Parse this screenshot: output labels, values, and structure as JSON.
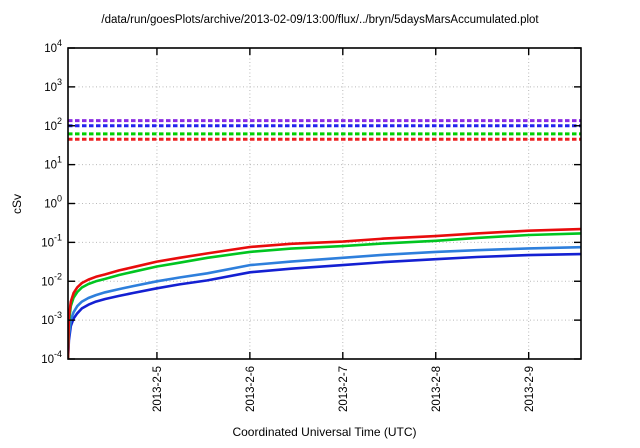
{
  "chart_data": {
    "type": "line",
    "title": "/data/run/goesPlots/archive/2013-02-09/13:00/flux/../bryn/5daysMarsAccumulated.plot",
    "xlabel": "Coordinated Universal Time (UTC)",
    "ylabel": "cSv",
    "y_scale": "log",
    "grid": true,
    "grid_color": "#b9b9b9",
    "frame_color": "#000000",
    "ylim_exponents": [
      -4,
      4
    ],
    "y_ticks_exponents": [
      4,
      3,
      2,
      1,
      0,
      -1,
      -2,
      -3,
      -4
    ],
    "y_tick_base": "10",
    "x_range_days": [
      0,
      5.52
    ],
    "x_ticks": [
      {
        "label": "2013-2-5",
        "t": 0.957
      },
      {
        "label": "2013-2-6",
        "t": 1.957
      },
      {
        "label": "2013-2-7",
        "t": 2.957
      },
      {
        "label": "2013-2-8",
        "t": 3.957
      },
      {
        "label": "2013-2-9",
        "t": 4.957
      }
    ],
    "reference_lines": [
      {
        "name": "limit-red",
        "value_cSv": 45,
        "color": "#ee2020",
        "style": "dashed"
      },
      {
        "name": "limit-green",
        "value_cSv": 62,
        "color": "#00d000",
        "style": "dashed"
      },
      {
        "name": "limit-blue",
        "value_cSv": 100,
        "color": "#2222ee",
        "style": "dashed"
      },
      {
        "name": "limit-purple",
        "value_cSv": 135,
        "color": "#8a2be2",
        "style": "dashed"
      }
    ],
    "t_samples_days": [
      0,
      0.01,
      0.03,
      0.06,
      0.1,
      0.15,
      0.22,
      0.3,
      0.4,
      0.55,
      0.7,
      0.957,
      1.2,
      1.5,
      1.957,
      2.4,
      2.957,
      3.4,
      3.957,
      4.4,
      4.957,
      5.52
    ],
    "series": [
      {
        "name": "accumulated-dose-dark-blue",
        "color": "#1420d2",
        "values": [
          0.0001,
          0.0003,
          0.0007,
          0.0011,
          0.0015,
          0.002,
          0.0025,
          0.003,
          0.0035,
          0.0042,
          0.005,
          0.0066,
          0.0083,
          0.0105,
          0.017,
          0.021,
          0.026,
          0.031,
          0.037,
          0.042,
          0.047,
          0.05
        ]
      },
      {
        "name": "accumulated-dose-light-blue",
        "color": "#2e7fdc",
        "values": [
          0.0001,
          0.0004,
          0.001,
          0.0016,
          0.0023,
          0.003,
          0.0037,
          0.0044,
          0.0052,
          0.0063,
          0.0075,
          0.01,
          0.0125,
          0.016,
          0.026,
          0.032,
          0.04,
          0.048,
          0.057,
          0.063,
          0.07,
          0.075
        ]
      },
      {
        "name": "accumulated-dose-green",
        "color": "#00c520",
        "values": [
          0.0001,
          0.0009,
          0.0023,
          0.0038,
          0.0053,
          0.0069,
          0.0085,
          0.01,
          0.0115,
          0.0145,
          0.0175,
          0.024,
          0.03,
          0.04,
          0.057,
          0.069,
          0.08,
          0.094,
          0.11,
          0.13,
          0.155,
          0.17
        ]
      },
      {
        "name": "accumulated-dose-red",
        "color": "#e80c0c",
        "values": [
          0.0001,
          0.0012,
          0.003,
          0.005,
          0.007,
          0.009,
          0.011,
          0.013,
          0.015,
          0.019,
          0.023,
          0.032,
          0.04,
          0.052,
          0.076,
          0.092,
          0.105,
          0.125,
          0.145,
          0.17,
          0.2,
          0.22
        ]
      }
    ],
    "legend": "none"
  }
}
